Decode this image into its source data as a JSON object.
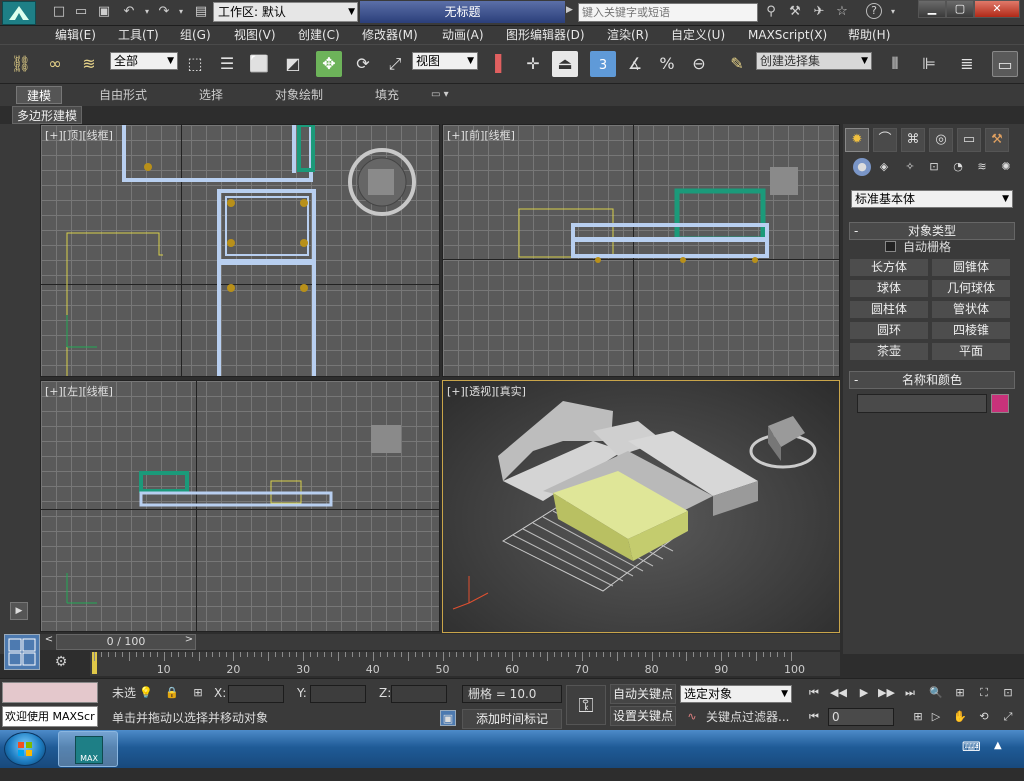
{
  "title_bar": {
    "workspace_label": "工作区: 默认",
    "document_title": "无标题",
    "search_placeholder": "键入关键字或短语",
    "icons": [
      "undo-icon",
      "redo-icon",
      "binoculars-icon",
      "wrench-icon",
      "star-icon",
      "help-icon"
    ]
  },
  "menu": [
    "编辑(E)",
    "工具(T)",
    "组(G)",
    "视图(V)",
    "创建(C)",
    "修改器(M)",
    "动画(A)",
    "图形编辑器(D)",
    "渲染(R)",
    "自定义(U)",
    "MAXScript(X)",
    "帮助(H)"
  ],
  "toolbar": {
    "selection_filter": "全部",
    "reference_coord": "视图",
    "selection_set": "创建选择集",
    "snap_label": "3",
    "percent_label": "%"
  },
  "ribbon": {
    "tabs": [
      "建模",
      "自由形式",
      "选择",
      "对象绘制",
      "填充"
    ],
    "active_tab": "建模",
    "panel_label": "多边形建模"
  },
  "viewports": {
    "top": "[+][顶][线框]",
    "front": "[+][前][线框]",
    "left": "[+][左][线框]",
    "persp": "[+][透视][真实]"
  },
  "command_panel": {
    "category": "标准基本体",
    "object_type_title": "对象类型",
    "autogrid_label": "自动栅格",
    "object_buttons": [
      "长方体",
      "圆锥体",
      "球体",
      "几何球体",
      "圆柱体",
      "管状体",
      "圆环",
      "四棱锥",
      "茶壶",
      "平面"
    ],
    "name_color_title": "名称和颜色",
    "object_color": "#c8327a"
  },
  "timeline": {
    "frame_display": "0 / 100",
    "ticks": [
      "10",
      "20",
      "30",
      "40",
      "50",
      "60",
      "70",
      "80",
      "90",
      "100"
    ]
  },
  "status": {
    "welcome": "欢迎使用 MAXScr",
    "unselected": "未选",
    "x_label": "X:",
    "y_label": "Y:",
    "z_label": "Z:",
    "grid_label": "栅格 = 10.0",
    "prompt": "单击并拖动以选择并移动对象",
    "add_time_tag": "添加时间标记",
    "auto_key": "自动关键点",
    "set_key": "设置关键点",
    "key_mode": "选定对象",
    "key_filters": "关键点过滤器...",
    "current_frame": "0"
  },
  "taskbar": {
    "max_label": "MAX"
  }
}
